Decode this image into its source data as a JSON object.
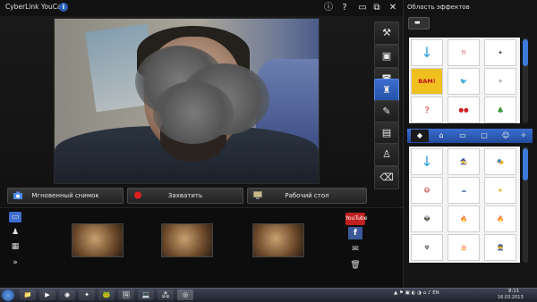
{
  "window": {
    "title": "CyberLink YouCam",
    "info_badge": "i",
    "buttons": {
      "info": "ⓘ",
      "help": "?",
      "minimize": "▭",
      "restore": "⧉",
      "close": "✕"
    }
  },
  "capture_buttons": {
    "snapshot": "Мгновенный снимок",
    "record": "Захватить",
    "desktop": "Рабочий стол"
  },
  "sidebar_tools": [
    "tools-icon",
    "screen-icon",
    "camera-icon",
    "avatar-icon",
    "brush-icon",
    "image-edit-icon",
    "person-add-icon",
    "eraser-icon"
  ],
  "left_tools": [
    "view-toggle-icon",
    "person-icon",
    "film-icon",
    "expand-icon"
  ],
  "thumbnails": [
    "photo-1",
    "photo-2",
    "photo-3"
  ],
  "share": {
    "youtube": "YouTube",
    "facebook": "f",
    "email": "✉",
    "trash": "🗑"
  },
  "effects_panel": {
    "title": "Область эффектов",
    "top_grid": [
      "↓",
      "?!",
      "✦",
      "BAM!",
      "🐦",
      "✧",
      "❓",
      "●●",
      "🎄"
    ],
    "bottom_grid": [
      "↓",
      "🧙",
      "🎭",
      "😷",
      "☁",
      "★",
      "👽",
      "🔥",
      "🔥",
      "☢",
      "🎂",
      "👮"
    ],
    "tabs": [
      "◆",
      "⌂",
      "▭",
      "▢",
      "☺",
      "✧"
    ]
  },
  "taskbar": {
    "apps": [
      "📁",
      "▶",
      "◉",
      "✦",
      "🐸",
      "🖼",
      "💻",
      "🖧",
      "◎"
    ],
    "time": "8:11",
    "date": "16.03.2013",
    "tray_icons": "▲ ⚑ ▣ ◐ ◑ ⌂ ♪ EN"
  },
  "colors": {
    "accent": "#3c6ed0",
    "record": "#e02020"
  }
}
